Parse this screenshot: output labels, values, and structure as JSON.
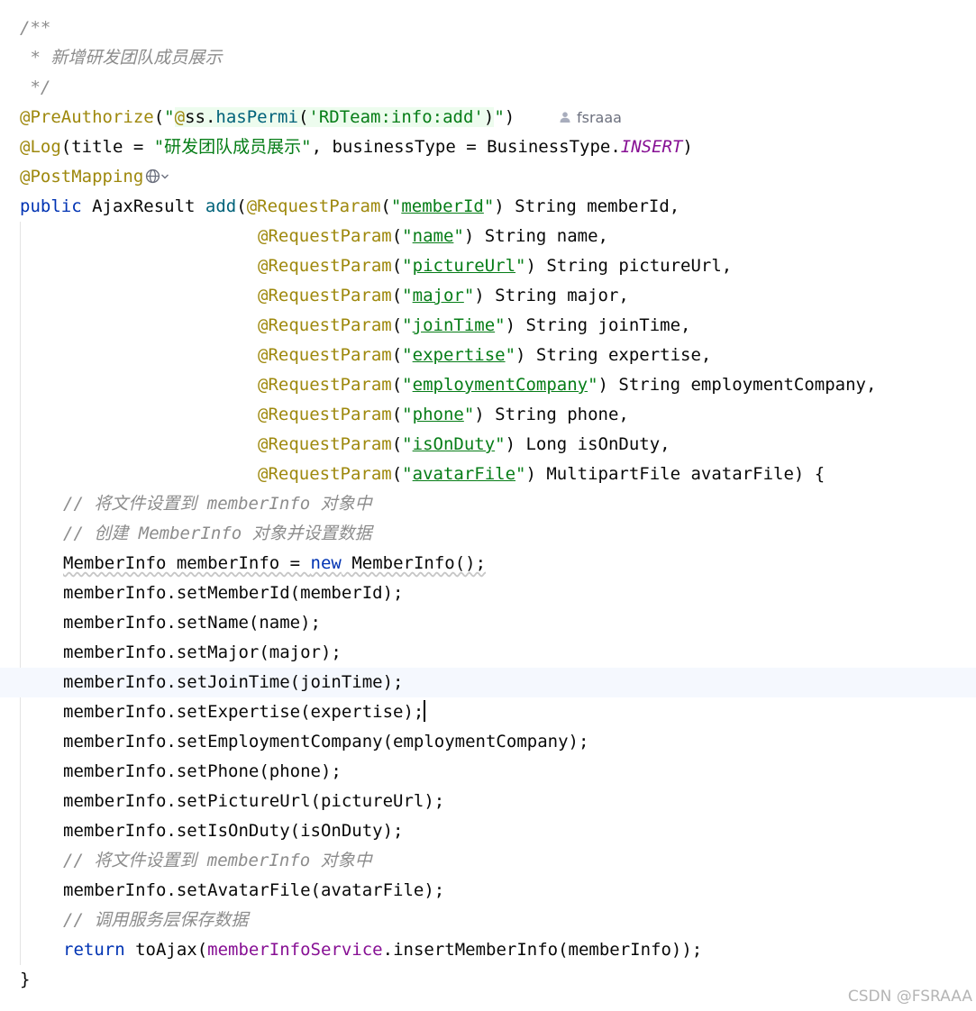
{
  "editor": {
    "author_name": "fsraaa",
    "watermark": "CSDN @FSRAAA",
    "current_line": 23,
    "lines": [
      {
        "indent": 22,
        "tokens": [
          {
            "t": "/**",
            "c": "comment"
          }
        ]
      },
      {
        "indent": 22,
        "tokens": [
          {
            "t": " * 新增研发团队成员展示",
            "c": "comment"
          }
        ]
      },
      {
        "indent": 22,
        "tokens": [
          {
            "t": " */",
            "c": "comment"
          }
        ]
      },
      {
        "indent": 22,
        "author": true,
        "tokens": [
          {
            "t": "@PreAuthorize",
            "c": "annotation"
          },
          {
            "t": "(",
            "c": "plain"
          },
          {
            "t": "\"",
            "c": "string"
          },
          {
            "t": "@",
            "c": "annotation",
            "bg": true
          },
          {
            "t": "ss",
            "c": "plain",
            "bg": true
          },
          {
            "t": ".",
            "c": "plain",
            "bg": true
          },
          {
            "t": "hasPermi",
            "c": "method",
            "bg": true
          },
          {
            "t": "(",
            "c": "plain",
            "bg": true
          },
          {
            "t": "'RDTeam:info:add'",
            "c": "string",
            "bg": true
          },
          {
            "t": ")",
            "c": "plain",
            "bg": true
          },
          {
            "t": "\"",
            "c": "string"
          },
          {
            "t": ")",
            "c": "plain"
          }
        ]
      },
      {
        "indent": 22,
        "tokens": [
          {
            "t": "@Log",
            "c": "annotation"
          },
          {
            "t": "(title = ",
            "c": "plain"
          },
          {
            "t": "\"研发团队成员展示\"",
            "c": "string"
          },
          {
            "t": ", businessType = BusinessType.",
            "c": "plain"
          },
          {
            "t": "INSERT",
            "c": "static"
          },
          {
            "t": ")",
            "c": "plain"
          }
        ]
      },
      {
        "indent": 22,
        "globe": true,
        "tokens": [
          {
            "t": "@PostMapping",
            "c": "annotation"
          }
        ]
      },
      {
        "indent": 22,
        "tokens": [
          {
            "t": "public",
            "c": "keyword"
          },
          {
            "t": " AjaxResult ",
            "c": "plain"
          },
          {
            "t": "add",
            "c": "method"
          },
          {
            "t": "(",
            "c": "plain"
          },
          {
            "t": "@RequestParam",
            "c": "annotation"
          },
          {
            "t": "(",
            "c": "plain"
          },
          {
            "t": "\"",
            "c": "string"
          },
          {
            "t": "memberId",
            "c": "string-ul"
          },
          {
            "t": "\"",
            "c": "string"
          },
          {
            "t": ") String memberId,",
            "c": "plain"
          }
        ]
      },
      {
        "indent": 286,
        "tokens": [
          {
            "t": "@RequestParam",
            "c": "annotation"
          },
          {
            "t": "(",
            "c": "plain"
          },
          {
            "t": "\"",
            "c": "string"
          },
          {
            "t": "name",
            "c": "string-ul"
          },
          {
            "t": "\"",
            "c": "string"
          },
          {
            "t": ") String name,",
            "c": "plain"
          }
        ]
      },
      {
        "indent": 286,
        "tokens": [
          {
            "t": "@RequestParam",
            "c": "annotation"
          },
          {
            "t": "(",
            "c": "plain"
          },
          {
            "t": "\"",
            "c": "string"
          },
          {
            "t": "pictureUrl",
            "c": "string-ul"
          },
          {
            "t": "\"",
            "c": "string"
          },
          {
            "t": ") String pictureUrl,",
            "c": "plain"
          }
        ]
      },
      {
        "indent": 286,
        "tokens": [
          {
            "t": "@RequestParam",
            "c": "annotation"
          },
          {
            "t": "(",
            "c": "plain"
          },
          {
            "t": "\"",
            "c": "string"
          },
          {
            "t": "major",
            "c": "string-ul"
          },
          {
            "t": "\"",
            "c": "string"
          },
          {
            "t": ") String major,",
            "c": "plain"
          }
        ]
      },
      {
        "indent": 286,
        "tokens": [
          {
            "t": "@RequestParam",
            "c": "annotation"
          },
          {
            "t": "(",
            "c": "plain"
          },
          {
            "t": "\"",
            "c": "string"
          },
          {
            "t": "joinTime",
            "c": "string-ul"
          },
          {
            "t": "\"",
            "c": "string"
          },
          {
            "t": ") String joinTime,",
            "c": "plain"
          }
        ]
      },
      {
        "indent": 286,
        "tokens": [
          {
            "t": "@RequestParam",
            "c": "annotation"
          },
          {
            "t": "(",
            "c": "plain"
          },
          {
            "t": "\"",
            "c": "string"
          },
          {
            "t": "expertise",
            "c": "string-ul"
          },
          {
            "t": "\"",
            "c": "string"
          },
          {
            "t": ") String expertise,",
            "c": "plain"
          }
        ]
      },
      {
        "indent": 286,
        "tokens": [
          {
            "t": "@RequestParam",
            "c": "annotation"
          },
          {
            "t": "(",
            "c": "plain"
          },
          {
            "t": "\"",
            "c": "string"
          },
          {
            "t": "employmentCompany",
            "c": "string-ul"
          },
          {
            "t": "\"",
            "c": "string"
          },
          {
            "t": ") String employmentCompany,",
            "c": "plain"
          }
        ]
      },
      {
        "indent": 286,
        "tokens": [
          {
            "t": "@RequestParam",
            "c": "annotation"
          },
          {
            "t": "(",
            "c": "plain"
          },
          {
            "t": "\"",
            "c": "string"
          },
          {
            "t": "phone",
            "c": "string-ul"
          },
          {
            "t": "\"",
            "c": "string"
          },
          {
            "t": ") String phone,",
            "c": "plain"
          }
        ]
      },
      {
        "indent": 286,
        "tokens": [
          {
            "t": "@RequestParam",
            "c": "annotation"
          },
          {
            "t": "(",
            "c": "plain"
          },
          {
            "t": "\"",
            "c": "string"
          },
          {
            "t": "isOnDuty",
            "c": "string-ul"
          },
          {
            "t": "\"",
            "c": "string"
          },
          {
            "t": ") Long isOnDuty,",
            "c": "plain"
          }
        ]
      },
      {
        "indent": 286,
        "tokens": [
          {
            "t": "@RequestParam",
            "c": "annotation"
          },
          {
            "t": "(",
            "c": "plain"
          },
          {
            "t": "\"",
            "c": "string"
          },
          {
            "t": "avatarFile",
            "c": "string-ul"
          },
          {
            "t": "\"",
            "c": "string"
          },
          {
            "t": ") MultipartFile avatarFile) {",
            "c": "plain"
          }
        ]
      },
      {
        "indent": 70,
        "tokens": [
          {
            "t": "// 将文件设置到 memberInfo 对象中",
            "c": "comment"
          }
        ]
      },
      {
        "indent": 70,
        "tokens": [
          {
            "t": "// 创建 MemberInfo 对象并设置数据",
            "c": "comment"
          }
        ]
      },
      {
        "indent": 70,
        "tokens": [
          {
            "t": "MemberInfo memberInfo = ",
            "c": "plain",
            "warn": true
          },
          {
            "t": "new",
            "c": "keyword",
            "warn": true
          },
          {
            "t": " MemberInfo();",
            "c": "plain",
            "warn": true
          }
        ]
      },
      {
        "indent": 70,
        "tokens": [
          {
            "t": "memberInfo.setMemberId(memberId);",
            "c": "plain"
          }
        ]
      },
      {
        "indent": 70,
        "tokens": [
          {
            "t": "memberInfo.setName(name);",
            "c": "plain"
          }
        ]
      },
      {
        "indent": 70,
        "tokens": [
          {
            "t": "memberInfo.setMajor(major);",
            "c": "plain"
          }
        ]
      },
      {
        "indent": 70,
        "tokens": [
          {
            "t": "memberInfo.setJoinTime(joinTime);",
            "c": "plain"
          }
        ]
      },
      {
        "indent": 70,
        "caret": true,
        "tokens": [
          {
            "t": "memberInfo.setExpertise(expertise);",
            "c": "plain"
          }
        ]
      },
      {
        "indent": 70,
        "tokens": [
          {
            "t": "memberInfo.setEmploymentCompany(employmentCompany);",
            "c": "plain"
          }
        ]
      },
      {
        "indent": 70,
        "tokens": [
          {
            "t": "memberInfo.setPhone(phone);",
            "c": "plain"
          }
        ]
      },
      {
        "indent": 70,
        "tokens": [
          {
            "t": "memberInfo.setPictureUrl(pictureUrl);",
            "c": "plain"
          }
        ]
      },
      {
        "indent": 70,
        "tokens": [
          {
            "t": "memberInfo.setIsOnDuty(isOnDuty);",
            "c": "plain"
          }
        ]
      },
      {
        "indent": 70,
        "tokens": [
          {
            "t": "// 将文件设置到 memberInfo 对象中",
            "c": "comment"
          }
        ]
      },
      {
        "indent": 70,
        "tokens": [
          {
            "t": "memberInfo.setAvatarFile(avatarFile);",
            "c": "plain"
          }
        ]
      },
      {
        "indent": 70,
        "tokens": [
          {
            "t": "// 调用服务层保存数据",
            "c": "comment"
          }
        ]
      },
      {
        "indent": 70,
        "tokens": [
          {
            "t": "return",
            "c": "keyword"
          },
          {
            "t": " toAjax(",
            "c": "plain"
          },
          {
            "t": "memberInfoService",
            "c": "field"
          },
          {
            "t": ".insertMemberInfo(memberInfo));",
            "c": "plain"
          }
        ]
      },
      {
        "indent": 22,
        "tokens": [
          {
            "t": "}",
            "c": "plain"
          }
        ]
      }
    ]
  }
}
